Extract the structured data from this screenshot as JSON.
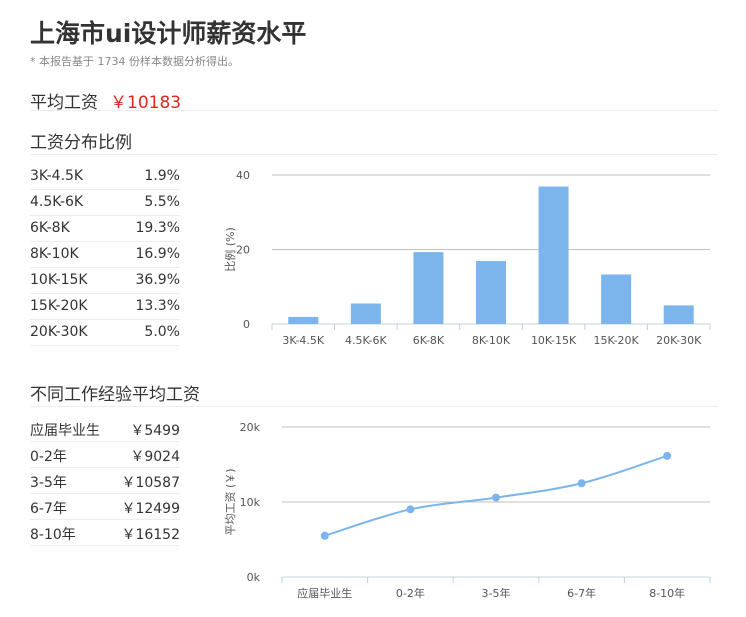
{
  "page": {
    "title": "上海市ui设计师薪资水平",
    "note": "* 本报告基于 1734 份样本数据分析得出。"
  },
  "average": {
    "label": "平均工资",
    "value": "￥10183"
  },
  "distribution": {
    "heading": "工资分布比例",
    "rows": [
      {
        "range": "3K-4.5K",
        "pct": "1.9%"
      },
      {
        "range": "4.5K-6K",
        "pct": "5.5%"
      },
      {
        "range": "6K-8K",
        "pct": "19.3%"
      },
      {
        "range": "8K-10K",
        "pct": "16.9%"
      },
      {
        "range": "10K-15K",
        "pct": "36.9%"
      },
      {
        "range": "15K-20K",
        "pct": "13.3%"
      },
      {
        "range": "20K-30K",
        "pct": "5.0%"
      }
    ]
  },
  "experience": {
    "heading": "不同工作经验平均工资",
    "rows": [
      {
        "level": "应届毕业生",
        "salary": "￥5499"
      },
      {
        "level": "0-2年",
        "salary": "￥9024"
      },
      {
        "level": "3-5年",
        "salary": "￥10587"
      },
      {
        "level": "6-7年",
        "salary": "￥12499"
      },
      {
        "level": "8-10年",
        "salary": "￥16152"
      }
    ]
  },
  "chart_data": [
    {
      "type": "bar",
      "categories": [
        "3K-4.5K",
        "4.5K-6K",
        "6K-8K",
        "8K-10K",
        "10K-15K",
        "15K-20K",
        "20K-30K"
      ],
      "values": [
        1.9,
        5.5,
        19.3,
        16.9,
        36.9,
        13.3,
        5.0
      ],
      "ylabel": "比例 (%)",
      "yticks": [
        "0",
        "20",
        "40"
      ],
      "ylim": [
        0,
        40
      ],
      "grid": true,
      "color": "#7cb5ec"
    },
    {
      "type": "line",
      "categories": [
        "应届毕业生",
        "0-2年",
        "3-5年",
        "6-7年",
        "8-10年"
      ],
      "values": [
        5499,
        9024,
        10587,
        12499,
        16152
      ],
      "ylabel": "平均工资 (￥)",
      "yticks": [
        "0k",
        "10k",
        "20k"
      ],
      "ylim": [
        0,
        20000
      ],
      "grid": true,
      "color": "#7cb5ec"
    }
  ]
}
